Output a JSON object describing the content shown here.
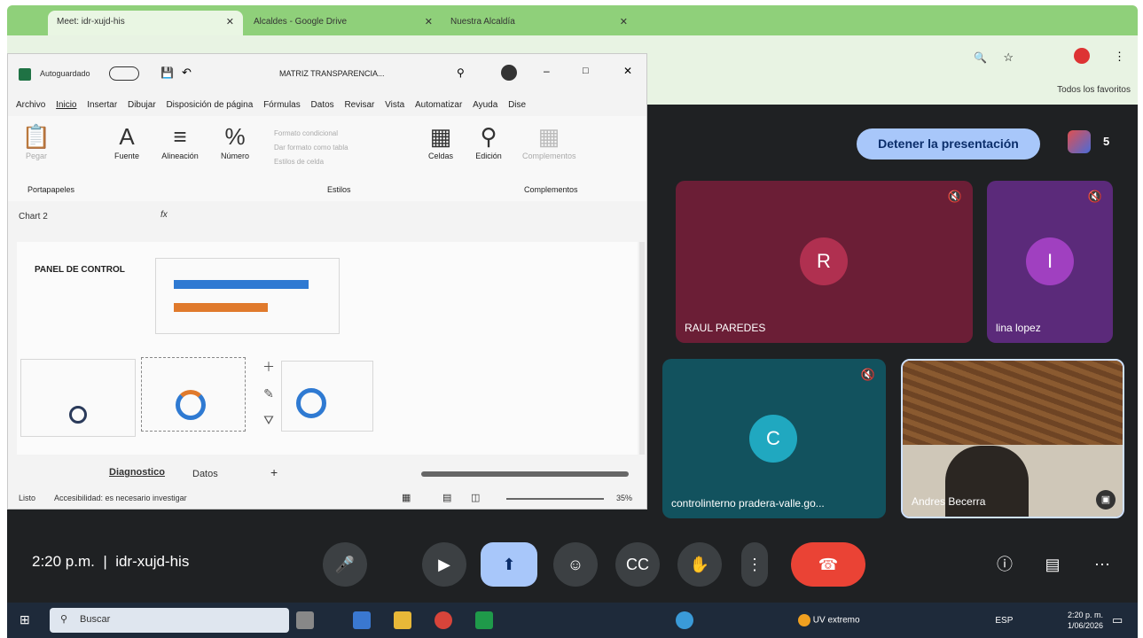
{
  "browser": {
    "tabs": [
      {
        "label": "Meet: idr-xujd-his"
      },
      {
        "label": "Alcaldes - Google Drive"
      },
      {
        "label": "Nuestra Alcaldía"
      }
    ],
    "bookmarks_label": "Todos los favoritos"
  },
  "excel": {
    "autosave_label": "Autoguardado",
    "file_name": "MATRIZ TRANSPARENCIA...",
    "menu": [
      "Archivo",
      "Inicio",
      "Insertar",
      "Dibujar",
      "Disposición de página",
      "Fórmulas",
      "Datos",
      "Revisar",
      "Vista",
      "Automatizar",
      "Ayuda",
      "Dise"
    ],
    "ribbon": {
      "paste": "Pegar",
      "font": "Fuente",
      "alignment": "Alineación",
      "number": "Número",
      "cond_format": "Formato condicional",
      "table_format": "Dar formato como tabla",
      "cell_styles": "Estilos de celda",
      "cells": "Celdas",
      "editing": "Edición",
      "addins": "Complementos",
      "group_clipboard": "Portapapeles",
      "group_styles": "Estilos",
      "group_addins": "Complementos"
    },
    "name_box": "Chart 2",
    "fx": "fx",
    "sheet": {
      "panel_title": "PANEL DE CONTROL"
    },
    "sheet_tabs": [
      "Diagnostico",
      "Datos"
    ],
    "status_ready": "Listo",
    "accessibility": "Accesibilidad: es necesario investigar",
    "zoom": "35%"
  },
  "meet": {
    "stop_presenting": "Detener la presentación",
    "participant_count": "5",
    "participants": [
      {
        "initial": "R",
        "name": "RAUL PAREDES"
      },
      {
        "initial": "I",
        "name": "lina lopez"
      },
      {
        "initial": "C",
        "name": "controlinterno pradera-valle.go..."
      },
      {
        "initial": "",
        "name": "Andres Becerra"
      }
    ],
    "time": "2:20 p.m.",
    "meeting_code": "idr-xujd-his"
  },
  "taskbar": {
    "search": "Buscar",
    "weather": "UV extremo",
    "lang": "ESP",
    "time": "2:20 p. m.",
    "date": "1/06/2026"
  }
}
